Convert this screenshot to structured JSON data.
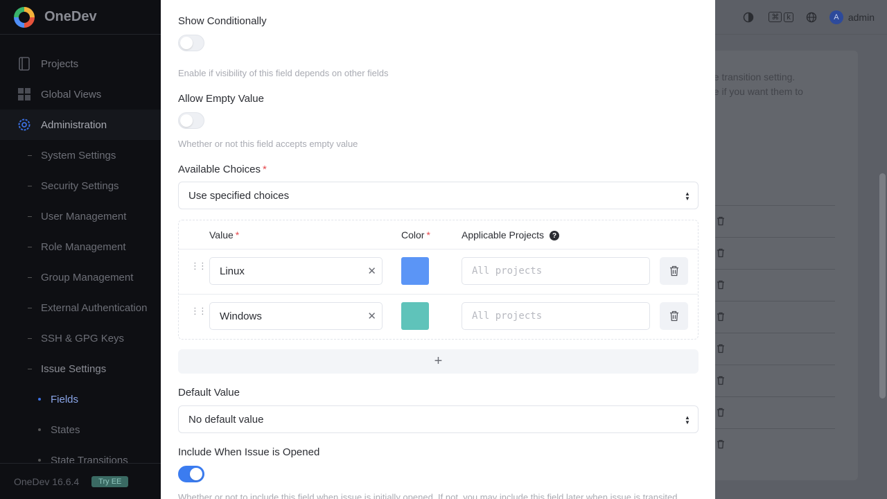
{
  "sidebar": {
    "brand": "OneDev",
    "nav": [
      {
        "label": "Projects",
        "icon": "projects-icon"
      },
      {
        "label": "Global Views",
        "icon": "grid-icon"
      },
      {
        "label": "Administration",
        "icon": "gear-icon"
      }
    ],
    "admin_items": [
      "System Settings",
      "Security Settings",
      "User Management",
      "Role Management",
      "Group Management",
      "External Authentication",
      "SSH & GPG Keys",
      "Issue Settings"
    ],
    "issue_items": [
      "Fields",
      "States",
      "State Transitions"
    ],
    "version": "OneDev 16.6.4",
    "try_badge": "Try EE"
  },
  "topbar": {
    "kbd1": "⌘",
    "kbd2": "k",
    "avatar_initial": "A",
    "user": "admin"
  },
  "background": {
    "text_line1": "ue transition setting.",
    "text_line2": "ge if you want them to"
  },
  "form": {
    "show_conditionally": {
      "label": "Show Conditionally",
      "hint": "Enable if visibility of this field depends on other fields",
      "on": false
    },
    "allow_empty": {
      "label": "Allow Empty Value",
      "hint": "Whether or not this field accepts empty value",
      "on": false
    },
    "available_choices": {
      "label": "Available Choices",
      "required_mark": "*",
      "selected": "Use specified choices"
    },
    "choices_table": {
      "col_value": "Value",
      "col_color": "Color",
      "col_projects": "Applicable Projects",
      "required_mark": "*",
      "help": "?",
      "rows": [
        {
          "value": "Linux",
          "color": "#5b95f6",
          "projects_placeholder": "All projects"
        },
        {
          "value": "Windows",
          "color": "#5fc3ba",
          "projects_placeholder": "All projects"
        }
      ],
      "add_label": "+"
    },
    "default_value": {
      "label": "Default Value",
      "selected": "No default value"
    },
    "include_when_opened": {
      "label": "Include When Issue is Opened",
      "hint": "Whether or not to include this field when issue is initially opened. If not, you may include this field later when issue is transited",
      "on": true
    }
  }
}
